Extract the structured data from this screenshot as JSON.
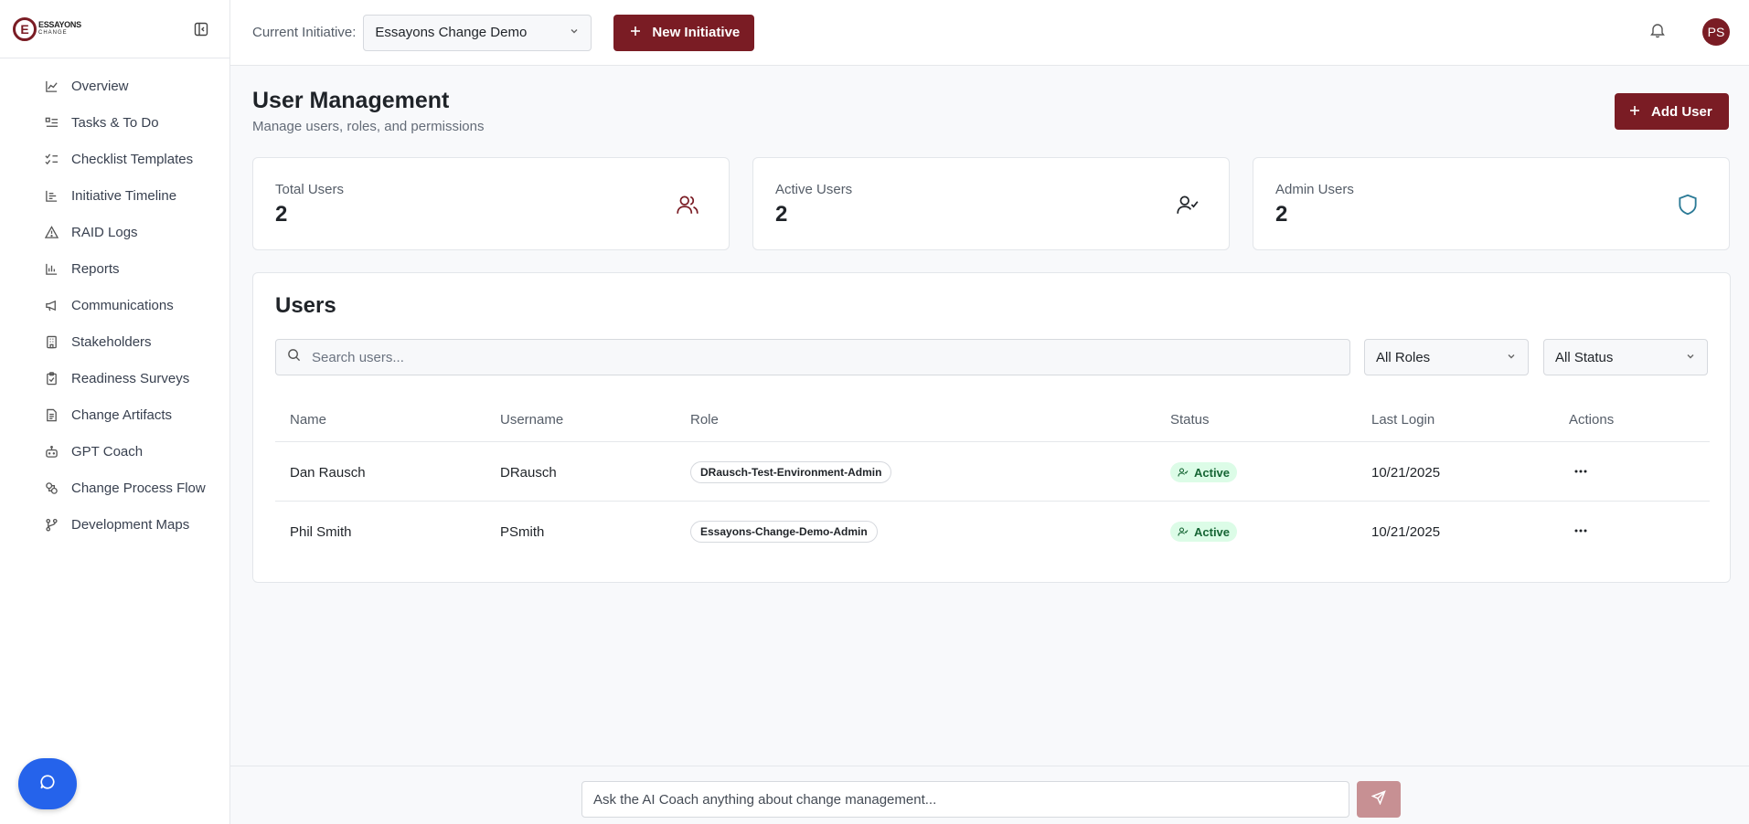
{
  "app": {
    "logo_line1": "ESSAYONS",
    "logo_line2": "CHANGE",
    "brand_color": "#7a1c24"
  },
  "sidebar": {
    "items": [
      {
        "label": "Overview",
        "icon": "chart-line-icon"
      },
      {
        "label": "Tasks & To Do",
        "icon": "list-todo-icon"
      },
      {
        "label": "Checklist Templates",
        "icon": "list-checks-icon"
      },
      {
        "label": "Initiative Timeline",
        "icon": "timeline-icon"
      },
      {
        "label": "RAID Logs",
        "icon": "alert-triangle-icon"
      },
      {
        "label": "Reports",
        "icon": "bar-chart-icon"
      },
      {
        "label": "Communications",
        "icon": "megaphone-icon"
      },
      {
        "label": "Stakeholders",
        "icon": "building-icon"
      },
      {
        "label": "Readiness Surveys",
        "icon": "clipboard-check-icon"
      },
      {
        "label": "Change Artifacts",
        "icon": "file-text-icon"
      },
      {
        "label": "GPT Coach",
        "icon": "bot-icon"
      },
      {
        "label": "Change Process Flow",
        "icon": "workflow-icon"
      },
      {
        "label": "Development Maps",
        "icon": "git-branch-icon"
      }
    ]
  },
  "header": {
    "initiative_label": "Current Initiative:",
    "initiative_value": "Essayons Change Demo",
    "new_initiative_label": "New Initiative",
    "avatar_initials": "PS"
  },
  "page": {
    "title": "User Management",
    "subtitle": "Manage users, roles, and permissions",
    "add_user_label": "Add User"
  },
  "stats": [
    {
      "label": "Total Users",
      "value": "2",
      "icon": "users-icon",
      "color": "#7a1c24"
    },
    {
      "label": "Active Users",
      "value": "2",
      "icon": "user-check-icon",
      "color": "#1f2328"
    },
    {
      "label": "Admin Users",
      "value": "2",
      "icon": "shield-icon",
      "color": "#2b7a96"
    }
  ],
  "users": {
    "title": "Users",
    "search_placeholder": "Search users...",
    "roles_filter": "All Roles",
    "status_filter": "All Status",
    "columns": [
      "Name",
      "Username",
      "Role",
      "Status",
      "Last Login",
      "Actions"
    ],
    "rows": [
      {
        "name": "Dan Rausch",
        "username": "DRausch",
        "role": "DRausch-Test-Environment-Admin",
        "status": "Active",
        "last_login": "10/21/2025"
      },
      {
        "name": "Phil Smith",
        "username": "PSmith",
        "role": "Essayons-Change-Demo-Admin",
        "status": "Active",
        "last_login": "10/21/2025"
      }
    ]
  },
  "chat": {
    "placeholder": "Ask the AI Coach anything about change management..."
  }
}
